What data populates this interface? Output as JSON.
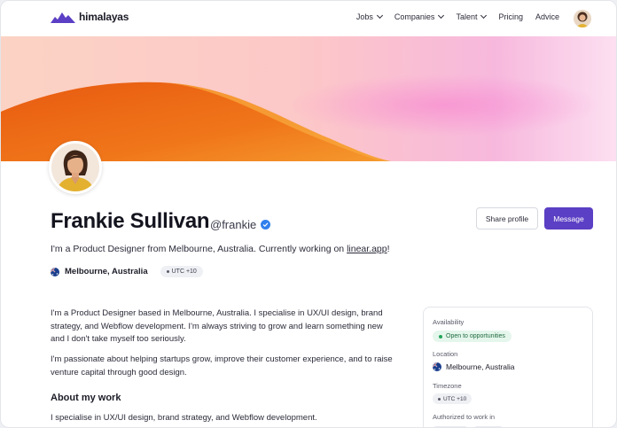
{
  "nav": {
    "brand": "himalayas",
    "links": [
      {
        "label": "Jobs",
        "dropdown": true
      },
      {
        "label": "Companies",
        "dropdown": true
      },
      {
        "label": "Talent",
        "dropdown": true
      },
      {
        "label": "Pricing",
        "dropdown": false
      },
      {
        "label": "Advice",
        "dropdown": false
      }
    ],
    "brand_color": "#5b3fc4"
  },
  "profile": {
    "name": "Frankie Sullivan",
    "handle": "@frankie",
    "tagline_prefix": "I'm a Product Designer from Melbourne, Australia. Currently working on ",
    "tagline_link": "linear.app",
    "tagline_suffix": "!",
    "location": "Melbourne, Australia",
    "timezone": "UTC +10"
  },
  "actions": {
    "share_label": "Share profile",
    "message_label": "Message"
  },
  "bio": {
    "paragraph1": "I'm a Product Designer based in Melbourne, Australia. I specialise in UX/UI design, brand strategy, and Webflow development. I'm always striving to grow and learn something new and I don't take myself too seriously.",
    "paragraph2": "I'm passionate about helping startups grow, improve their customer experience, and to raise venture capital through good design.",
    "about_title": "About my work",
    "about_text": "I specialise in UX/UI design, brand strategy, and Webflow development."
  },
  "sidecard": {
    "availability_label": "Availability",
    "availability_value": "Open to opportunities",
    "location_label": "Location",
    "location_value": "Melbourne, Australia",
    "timezone_label": "Timezone",
    "timezone_value": "UTC +10",
    "authorized_label": "Authorized to work in"
  },
  "colors": {
    "primary": "#5b3fc4",
    "available_green": "#22a559",
    "verified_blue": "#2f80ed"
  }
}
